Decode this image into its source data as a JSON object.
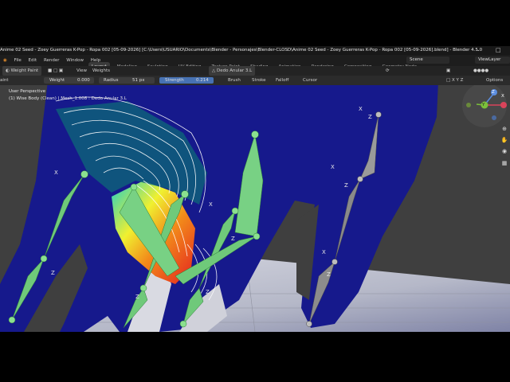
{
  "window": {
    "title": "Anime 02 Seed - Zoey Guerreras K-Pop - Ropa 002 [05-09-2026] [C:\\Users\\USUARIO\\Documents\\Blender - Personajes\\Blender-CLOSD\\Anime 02 Seed - Zoey Guerreras K-Pop - Ropa 002 [05-09-2026].blend] - Blender 4.5.0",
    "minimize_icon": "minimize-icon",
    "maximize_icon": "maximize-icon"
  },
  "menubar": {
    "items": [
      "File",
      "Edit",
      "Render",
      "Window",
      "Help"
    ],
    "workspaces": [
      "Layout",
      "Modeling",
      "Sculpting",
      "UV Editing",
      "Texture Paint",
      "Shading",
      "Animation",
      "Rendering",
      "Compositing",
      "Geometry Node"
    ],
    "active_workspace": "Layout",
    "scene": "Scene",
    "view_layer": "ViewLayer"
  },
  "header": {
    "mode": "Weight Paint",
    "view": "View",
    "weights": "Weights",
    "vertex_group": "Dedo Anular 3.L",
    "options": "Options"
  },
  "toolbar": {
    "mode_short": "aint",
    "weight_label": "Weight",
    "weight_value": "0.000",
    "radius_label": "Radius",
    "radius_value": "51 px",
    "strength_label": "Strength",
    "strength_value": "0.214",
    "brush": "Brush",
    "stroke": "Stroke",
    "falloff": "Falloff",
    "cursor": "Cursor"
  },
  "viewport": {
    "view_name": "User Perspective",
    "object_info": "(1) Wise Body (Clean) | Mesh_1.008 : Dedo Anular 3.L",
    "gizmo": {
      "x": "X",
      "y": "Y",
      "z": "Z"
    }
  },
  "colors": {
    "mesh": "#16198c",
    "bone_selected": "#6fc97a",
    "bone": "#8c8c8c",
    "floor": "#b9bcc9"
  }
}
